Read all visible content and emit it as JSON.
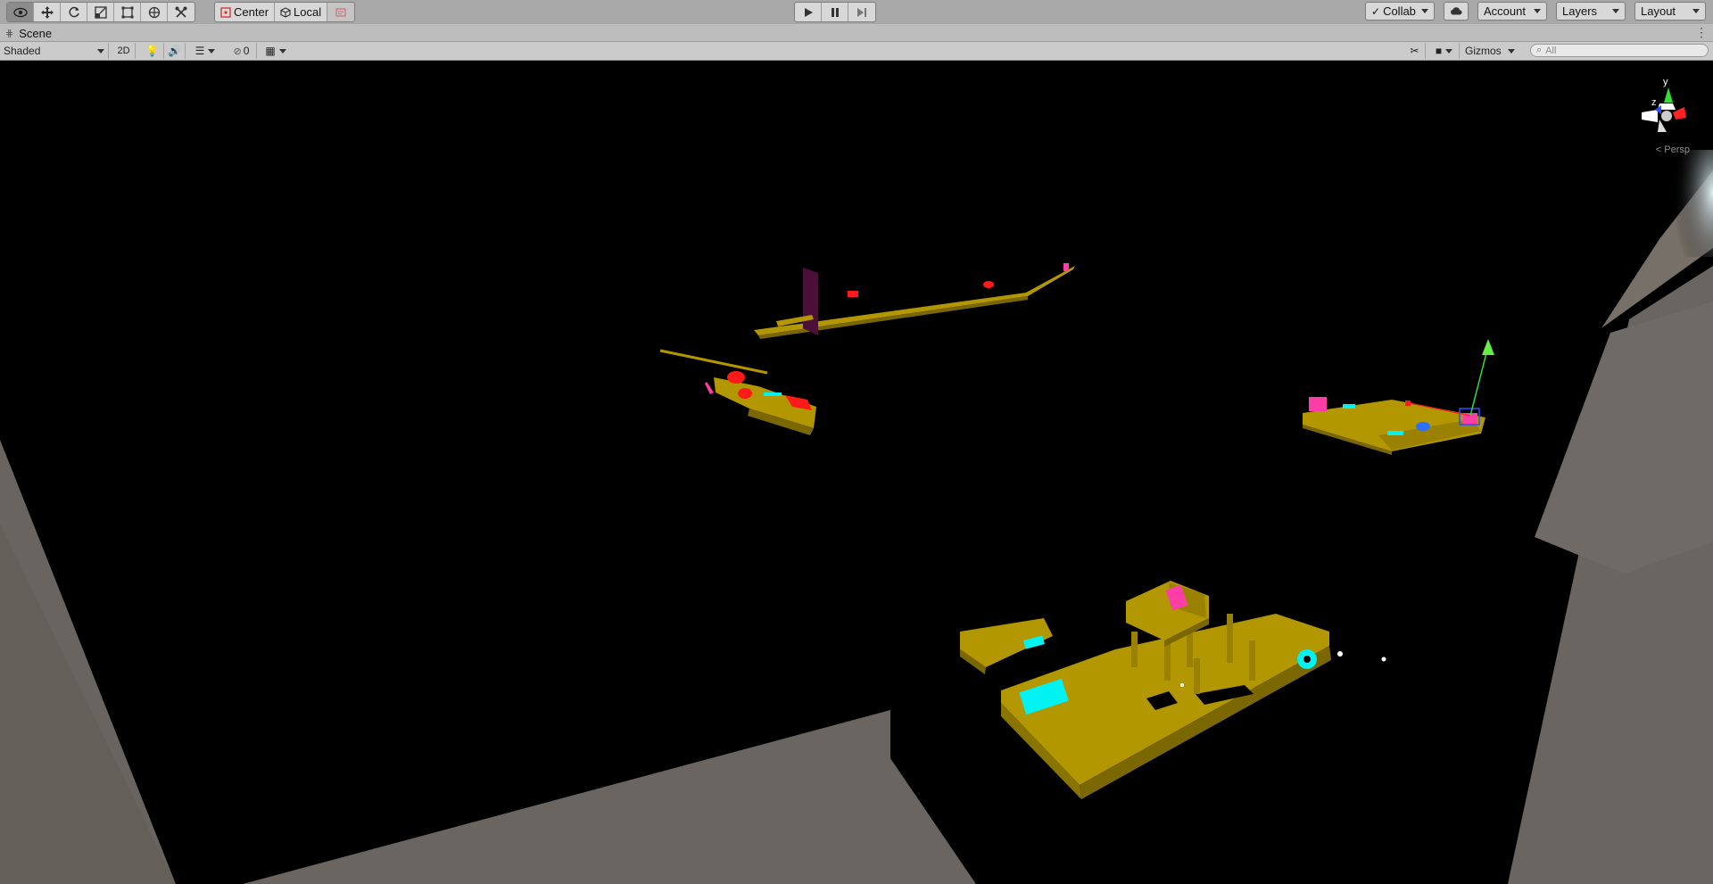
{
  "toolbar": {
    "tools": [
      {
        "icon": "eye-icon",
        "glyph": "👁"
      },
      {
        "icon": "move-icon",
        "glyph": "✥"
      },
      {
        "icon": "rotate-icon",
        "glyph": "⟳"
      },
      {
        "icon": "scale-icon",
        "glyph": "⤢"
      },
      {
        "icon": "rect-icon",
        "glyph": "▭"
      },
      {
        "icon": "transform-icon",
        "glyph": "⊕"
      },
      {
        "icon": "custom-tool-icon",
        "glyph": "✂"
      }
    ],
    "pivot_label": "Center",
    "space_label": "Local",
    "collab_label": "Collab",
    "account_label": "Account",
    "layers_label": "Layers",
    "layout_label": "Layout"
  },
  "scene_tab": {
    "title": "Scene"
  },
  "scene_controls": {
    "draw_mode": "Shaded",
    "mode_2d": "2D",
    "hidden_count": "0",
    "gizmos_label": "Gizmos",
    "search_placeholder": "All"
  },
  "viewport": {
    "perspective_label": "< Persp",
    "gizmo_axis_y": "y",
    "gizmo_axis_z": "z",
    "colors": {
      "background": "#000000",
      "ground": "#6a6560",
      "platform": "#b59a00",
      "accent_cyan": "#00f2f2",
      "accent_magenta": "#ff3da6",
      "accent_red": "#ff1a1a"
    }
  }
}
